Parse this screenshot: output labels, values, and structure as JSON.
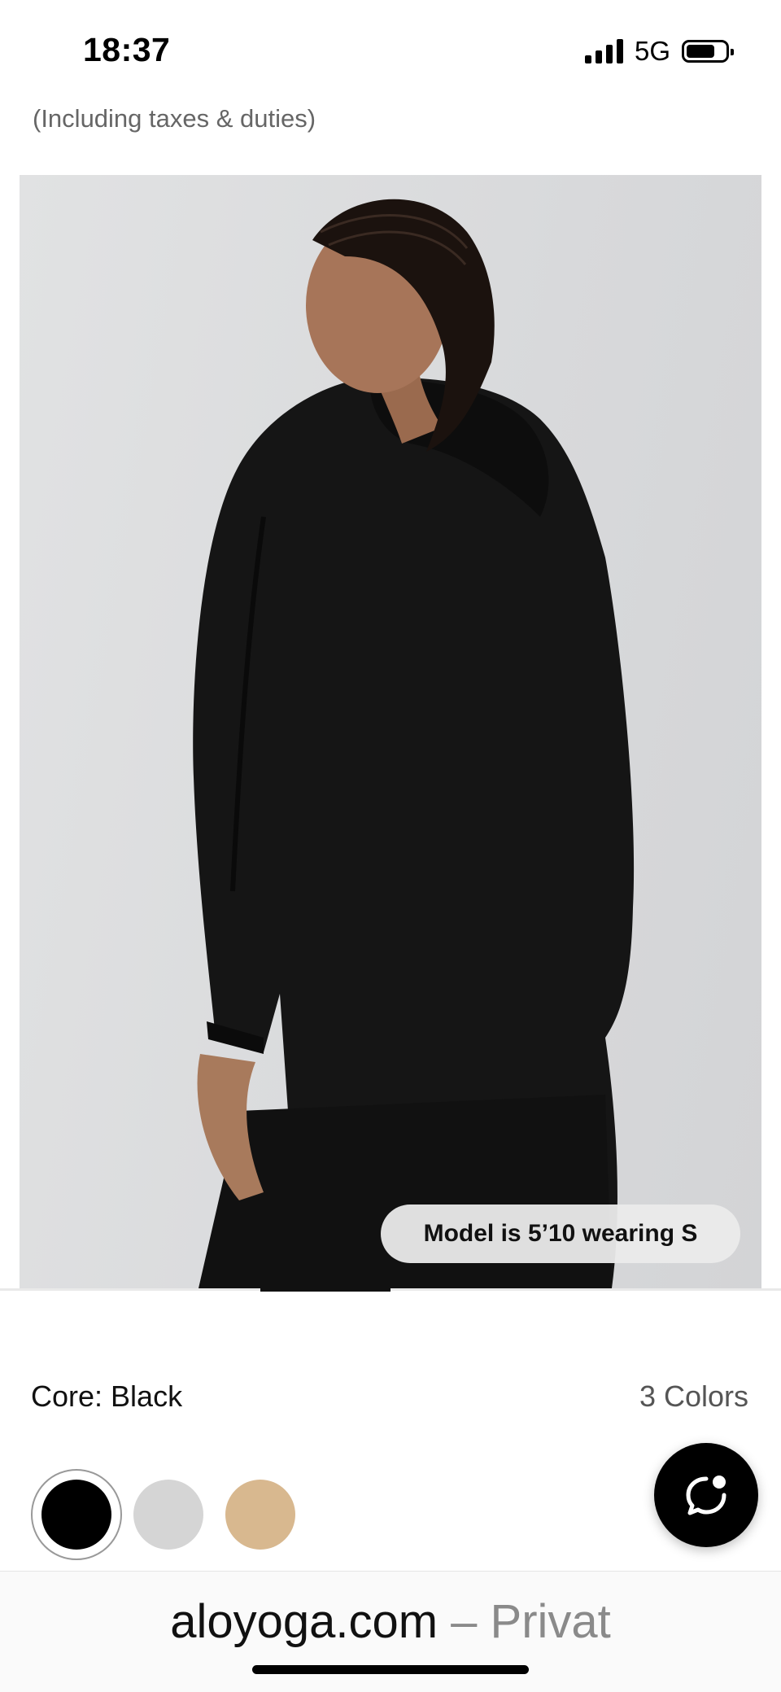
{
  "status_bar": {
    "time": "18:37",
    "network": "5G"
  },
  "product": {
    "price_note": "(Including taxes & duties)",
    "model_info": "Model is 5’10 wearing S",
    "color_label": "Core: Black",
    "colors_count": "3 Colors",
    "swatches": [
      {
        "name": "Black",
        "hex": "#000000",
        "selected": true
      },
      {
        "name": "Grey",
        "hex": "#d5d5d5",
        "selected": false
      },
      {
        "name": "Tan",
        "hex": "#d8b88f",
        "selected": false
      }
    ]
  },
  "browser": {
    "domain": "aloyoga.com",
    "suffix": " – Privat"
  },
  "icons": [
    "signal-icon",
    "battery-icon",
    "chat-icon"
  ]
}
